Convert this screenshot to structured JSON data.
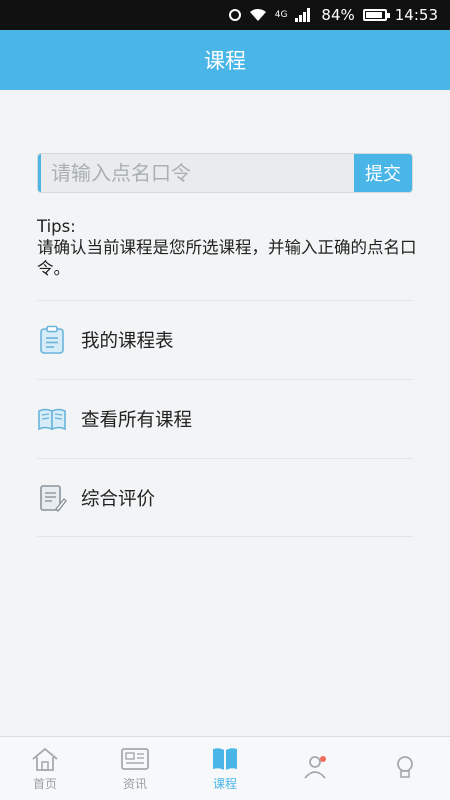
{
  "statusbar": {
    "network": "4G",
    "battery": "84%",
    "time": "14:53"
  },
  "header": {
    "title": "课程"
  },
  "search": {
    "placeholder": "请输入点名口令",
    "value": "",
    "submit_label": "提交"
  },
  "tips": {
    "heading": "Tips:",
    "text": "请确认当前课程是您所选课程，并输入正确的点名口令。"
  },
  "menu": {
    "items": [
      {
        "label": "我的课程表",
        "icon": "clipboard-icon"
      },
      {
        "label": "查看所有课程",
        "icon": "book-icon"
      },
      {
        "label": "综合评价",
        "icon": "document-edit-icon"
      }
    ]
  },
  "tabbar": {
    "items": [
      {
        "label": "首页",
        "icon": "home-icon",
        "active": false
      },
      {
        "label": "资讯",
        "icon": "news-icon",
        "active": false
      },
      {
        "label": "课程",
        "icon": "book-open-icon",
        "active": true
      },
      {
        "label": "",
        "icon": "user-icon",
        "active": false
      },
      {
        "label": "",
        "icon": "bulb-icon",
        "active": false
      }
    ]
  },
  "colors": {
    "accent": "#4ab6e8",
    "background": "#f2f4f5"
  }
}
